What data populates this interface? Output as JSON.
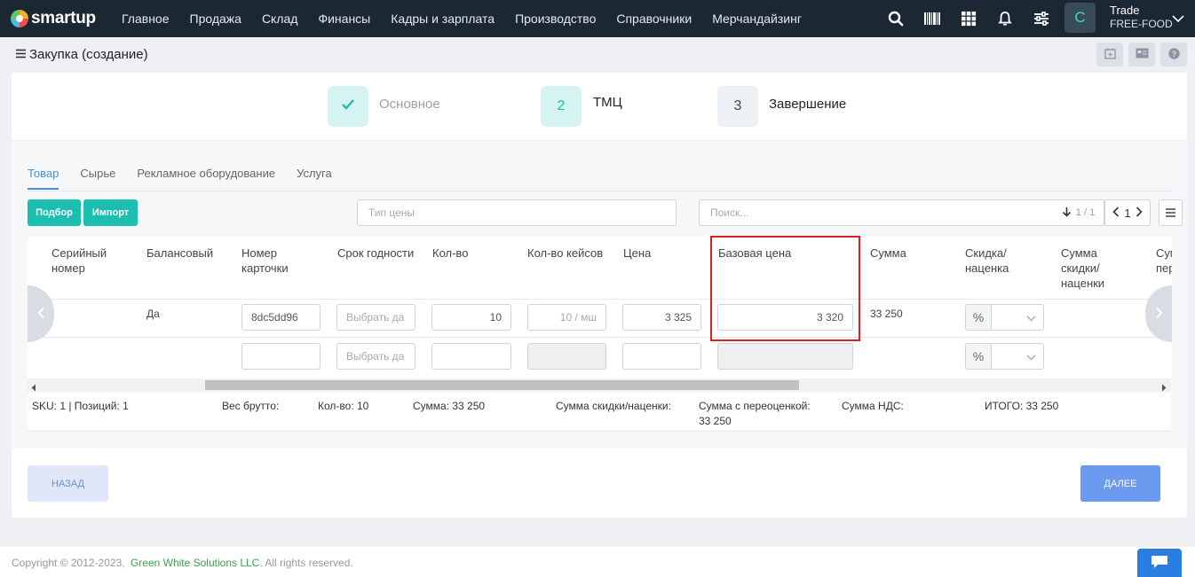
{
  "app": {
    "logo_text": "smartup",
    "menu": [
      "Главное",
      "Продажа",
      "Склад",
      "Финансы",
      "Кадры и зарплата",
      "Производство",
      "Справочники",
      "Мерчандайзинг"
    ],
    "icons": [
      "search-icon",
      "barcode-icon",
      "grid-icon",
      "bell-icon",
      "sliders-icon"
    ],
    "avatar_letter": "C",
    "account_line1": "Trade",
    "account_line2": "FREE-FOOD"
  },
  "page": {
    "title": "Закупка (создание)"
  },
  "stepper": {
    "steps": [
      {
        "number": "",
        "label": "Основное",
        "state": "done"
      },
      {
        "number": "2",
        "label": "ТМЦ",
        "state": "active"
      },
      {
        "number": "3",
        "label": "Завершение",
        "state": "pending"
      }
    ]
  },
  "tabs": [
    "Товар",
    "Сырье",
    "Рекламное оборудование",
    "Услуга"
  ],
  "toolbar": {
    "select_button": "Подбор",
    "import_button": "Импорт",
    "price_type_placeholder": "Тип цены",
    "search_placeholder": "Поиск...",
    "page_info": "1 / 1",
    "page_number": "1"
  },
  "table": {
    "headers": [
      "Серийный номер",
      "Балансовый",
      "Номер карточки",
      "Срок годности",
      "Кол-во",
      "Кол-во кейсов",
      "Цена",
      "Базовая цена",
      "Сумма",
      "Скидка/ наценка",
      "Сумма скидки/ наценки",
      "Сум пер"
    ],
    "row": {
      "balance": "Да",
      "card_number": "8dc5dd96",
      "expiry_placeholder": "Выбрать да",
      "qty": "10",
      "cases_placeholder": "10 / мш",
      "price": "3 325",
      "base_price": "3 320",
      "sum": "33 250",
      "pct_symbol": "%"
    },
    "empty_row": {
      "expiry_placeholder": "Выбрать да",
      "pct_symbol": "%"
    }
  },
  "summary": {
    "sku": "SKU: 1 | Позиций: 1",
    "gross_weight": "Вес брутто:",
    "qty": "Кол-во: 10",
    "sum": "Сумма: 33 250",
    "discount_sum": "Сумма скидки/наценки:",
    "revalued_label": "Сумма с переоценкой:",
    "revalued_value": "33 250",
    "vat": "Сумма НДС:",
    "total": "ИТОГО: 33 250"
  },
  "actions": {
    "back": "НАЗАД",
    "next": "ДАЛЕЕ"
  },
  "footer": {
    "copyright": "Copyright © 2012-2023,",
    "company": "Green White Solutions LLC.",
    "rights": "All rights reserved."
  },
  "colors": {
    "nav_bg": "#1b2733",
    "teal": "#1bbfb0",
    "accent_blue": "#4a8fd6",
    "highlight_red": "#e02020",
    "next_button": "#6b9af0"
  }
}
